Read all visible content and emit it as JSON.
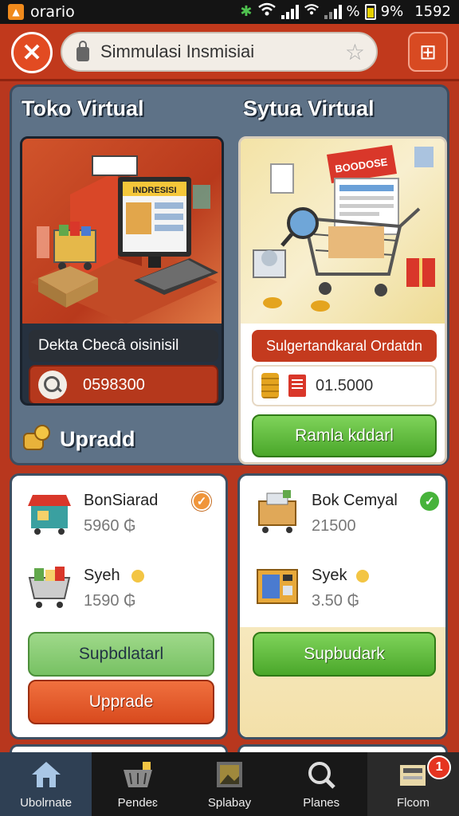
{
  "status_bar": {
    "carrier": "orario",
    "battery": "9%",
    "time": "1592"
  },
  "top_bar": {
    "url_text": "Simmulasi Insmisiai"
  },
  "main": {
    "left_title": "Toko Virtual",
    "right_title": "Sytua Virtual",
    "left_card": {
      "sign_text": "INDRESISI",
      "label": "Dekta Cbecâ oisinisil",
      "input_value": "0598300"
    },
    "right_card": {
      "sign_text": "BOODOSE",
      "label": "Sulgertandkaral Ordatdn",
      "value": "01.5000",
      "button": "Ramla kddarl"
    },
    "upgrade_label": "Upradd"
  },
  "card_a": {
    "items": [
      {
        "name": "BonSiarad",
        "price": "5960 ₲"
      },
      {
        "name": "Syeh",
        "price": "1590 ₲"
      }
    ],
    "button_green": "Supbdlatarl",
    "button_orange": "Upprade"
  },
  "card_b": {
    "items": [
      {
        "name": "Bok Cemyal",
        "price": "21500"
      },
      {
        "name": "Syek",
        "price": "3.50 ₲"
      }
    ],
    "button_green": "Supbudark"
  },
  "bottom_nav": {
    "items": [
      {
        "label": "Ubolrnate"
      },
      {
        "label": "Pendeɛ"
      },
      {
        "label": "Splabay"
      },
      {
        "label": "Planes"
      },
      {
        "label": "Flcom"
      }
    ],
    "notification": "1"
  }
}
